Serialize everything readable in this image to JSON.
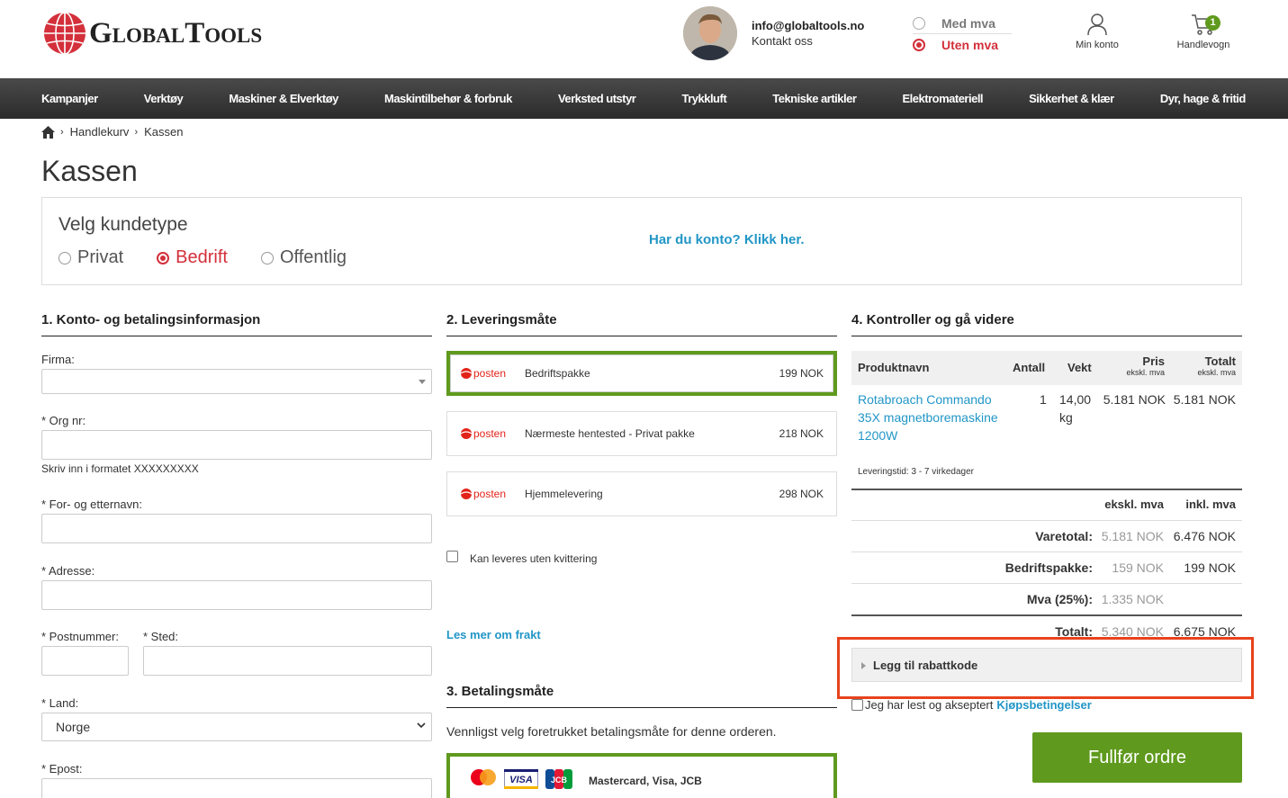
{
  "header": {
    "logo_text": "GlobalTools",
    "contact_email": "info@globaltools.no",
    "contact_label": "Kontakt oss",
    "vat_options": [
      "Med mva",
      "Uten mva"
    ],
    "vat_selected": "Uten mva",
    "account_label": "Min konto",
    "cart_label": "Handlevogn",
    "cart_count": "1"
  },
  "nav": {
    "items": [
      "Kampanjer",
      "Verktøy",
      "Maskiner & Elverktøy",
      "Maskintilbehør & forbruk",
      "Verksted utstyr",
      "Trykkluft",
      "Tekniske artikler",
      "Elektromateriell",
      "Sikkerhet & klær",
      "Dyr, hage & fritid"
    ]
  },
  "breadcrumb": {
    "items": [
      "Handlekurv",
      "Kassen"
    ]
  },
  "page_title": "Kassen",
  "customer_type": {
    "title": "Velg kundetype",
    "options": [
      "Privat",
      "Bedrift",
      "Offentlig"
    ],
    "selected": "Bedrift",
    "account_link": "Har du konto? Klikk her."
  },
  "section1": {
    "title": "1. Konto- og betalingsinformasjon",
    "firma_label": "Firma:",
    "orgnr_label": "* Org nr:",
    "orgnr_hint": "Skriv inn i formatet XXXXXXXXX",
    "name_label": "* For- og etternavn:",
    "address_label": "* Adresse:",
    "postnr_label": "* Postnummer:",
    "sted_label": "* Sted:",
    "land_label": "* Land:",
    "land_value": "Norge",
    "email_label": "* Epost:"
  },
  "section2": {
    "title": "2. Leveringsmåte",
    "carrier_logo": "posten",
    "options": [
      {
        "name": "Bedriftspakke",
        "price": "199 NOK"
      },
      {
        "name": "Nærmeste hentested - Privat pakke",
        "price": "218 NOK"
      },
      {
        "name": "Hjemmelevering",
        "price": "298 NOK"
      }
    ],
    "selected_index": 0,
    "no_receipt_label": "Kan leveres uten kvittering",
    "shipping_info_link": "Les mer om frakt"
  },
  "section3": {
    "title": "3. Betalingsmåte",
    "description": "Vennligst velg foretrukket betalingsmåte for denne orderen.",
    "option_name": "Mastercard, Visa, JCB"
  },
  "section4": {
    "title": "4. Kontroller og gå videre",
    "columns": {
      "product": "Produktnavn",
      "qty": "Antall",
      "weight": "Vekt",
      "price": "Pris",
      "price_sub": "ekskl. mva",
      "total": "Totalt",
      "total_sub": "ekskl. mva"
    },
    "product": {
      "name": "Rotabroach Commando 35X magnetboremaskine 1200W",
      "qty": "1",
      "weight": "14,00 kg",
      "price": "5.181 NOK",
      "total": "5.181 NOK",
      "delivery": "Leveringstid: 3 - 7 virkedager"
    },
    "totals_header": {
      "ex": "ekskl. mva",
      "inc": "inkl. mva"
    },
    "totals": [
      {
        "label": "Varetotal:",
        "ex": "5.181 NOK",
        "inc": "6.476 NOK"
      },
      {
        "label": "Bedriftspakke:",
        "ex": "159 NOK",
        "inc": "199 NOK"
      },
      {
        "label": "Mva (25%):",
        "ex": "1.335 NOK",
        "inc": ""
      },
      {
        "label": "Totalt:",
        "ex": "5.340 NOK",
        "inc": "6.675 NOK"
      }
    ],
    "discount_label": "Legg til rabattkode",
    "terms_text": "Jeg har lest og akseptert",
    "terms_link": "Kjøpsbetingelser",
    "submit_label": "Fullfør ordre"
  },
  "colors": {
    "accent_red": "#d3303b",
    "link_blue": "#2196c6",
    "green": "#5f9a1e",
    "highlight": "#e8431d"
  }
}
